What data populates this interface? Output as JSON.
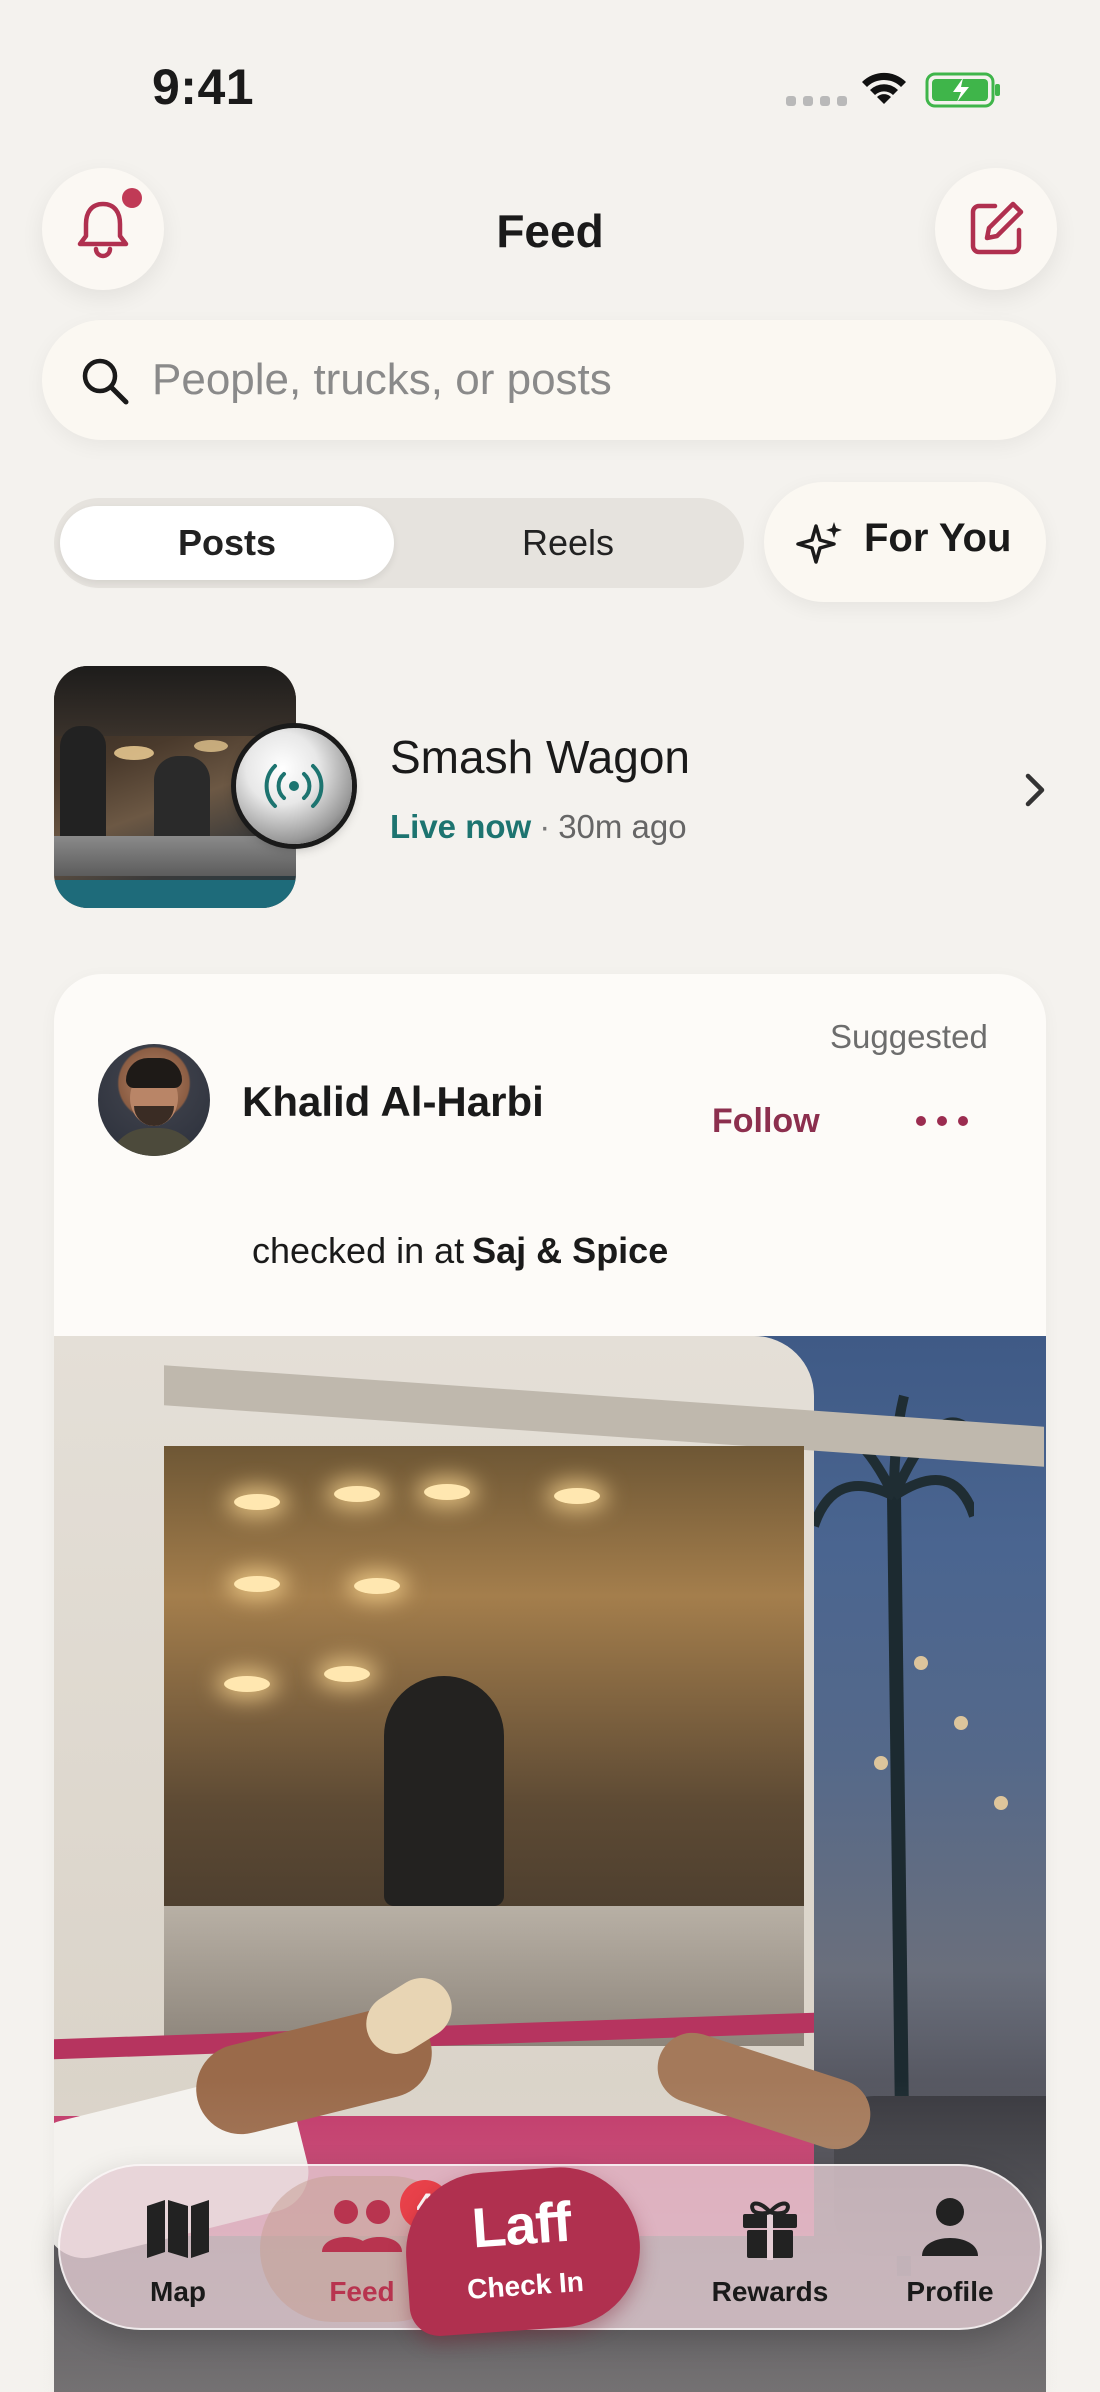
{
  "status_bar": {
    "time": "9:41"
  },
  "header": {
    "title": "Feed",
    "notification_icon": "bell-icon",
    "compose_icon": "compose-icon",
    "accent_color": "#b0304f"
  },
  "search": {
    "placeholder": "People, trucks, or posts",
    "value": ""
  },
  "segments": {
    "posts_label": "Posts",
    "reels_label": "Reels",
    "selected": "Posts",
    "for_you_label": "For You"
  },
  "live": {
    "truck_name": "Smash Wagon",
    "status": "Live now",
    "separator": "·",
    "time_ago": "30m ago",
    "status_color": "#1d7470"
  },
  "post": {
    "author": "Khalid Al-Harbi",
    "suggested_label": "Suggested",
    "follow_label": "Follow",
    "checkin_text": "checked in at",
    "place": "Saj & Spice"
  },
  "tab_bar": {
    "items": [
      {
        "label": "Map",
        "icon": "map-icon"
      },
      {
        "label": "Feed",
        "icon": "people-icon",
        "badge": "4",
        "active": true
      },
      {
        "label": "Check In",
        "logo": "Laff"
      },
      {
        "label": "Rewards",
        "icon": "gift-icon"
      },
      {
        "label": "Profile",
        "icon": "person-icon"
      }
    ]
  }
}
